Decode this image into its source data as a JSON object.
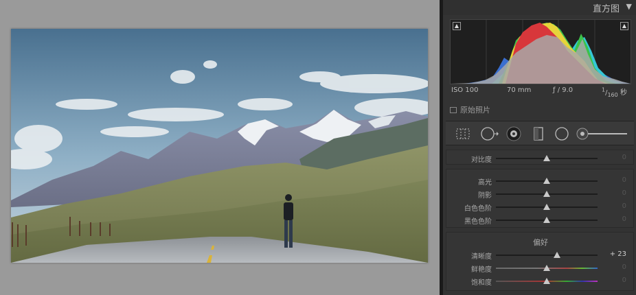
{
  "histogram": {
    "title": "直方图",
    "collapse_icon": "triangle-down-icon",
    "iso": "ISO 100",
    "focal": "70 mm",
    "aperture": "ƒ / 9.0",
    "shutter_prefix": "1",
    "shutter_den": "160",
    "shutter_unit": "秒",
    "original_label": "原始照片"
  },
  "tools": [
    "crop-overlay-icon",
    "spot-removal-icon",
    "red-eye-icon",
    "graduated-filter-icon",
    "radial-filter-icon",
    "adjustment-brush-icon"
  ],
  "basic": {
    "contrast": {
      "label": "对比度",
      "value": "0",
      "level": 0
    },
    "highlights": {
      "label": "高光",
      "value": "0",
      "level": 0
    },
    "shadows": {
      "label": "阴影",
      "value": "0",
      "level": 0
    },
    "whites": {
      "label": "白色色阶",
      "value": "0",
      "level": 0
    },
    "blacks": {
      "label": "黑色色阶",
      "value": "0",
      "level": 0
    }
  },
  "presence": {
    "title": "偏好",
    "clarity": {
      "label": "清晰度",
      "value": "+ 23",
      "level": 23
    },
    "vibrance": {
      "label": "鲜艳度",
      "value": "0",
      "level": 0
    },
    "saturation": {
      "label": "饱和度",
      "value": "0",
      "level": 0
    }
  },
  "colors": {
    "panel": "#333333",
    "canvas": "#9a9a9a"
  }
}
